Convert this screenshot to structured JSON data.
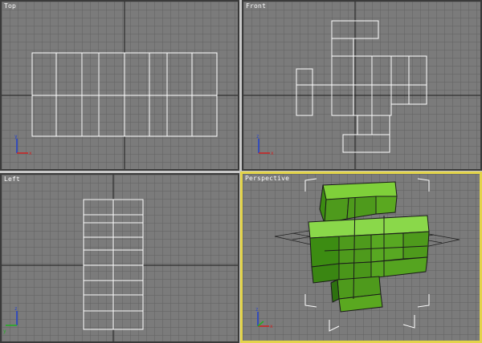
{
  "viewports": {
    "top": {
      "label": "Top"
    },
    "front": {
      "label": "Front"
    },
    "left": {
      "label": "Left"
    },
    "perspective": {
      "label": "Perspective",
      "active": true
    }
  },
  "colors": {
    "viewport_bg": "#7b7b7b",
    "grid_line": "#646464",
    "axis_line": "#1e1e1e",
    "wireframe": "#ffffff",
    "active_border": "#e3d44a",
    "mesh_green": "#4e9a1c",
    "axis_x": "#d02020",
    "axis_y": "#20b020",
    "axis_z": "#2040d0"
  },
  "axis_icons": [
    "x-axis-icon",
    "y-axis-icon",
    "z-axis-icon"
  ]
}
